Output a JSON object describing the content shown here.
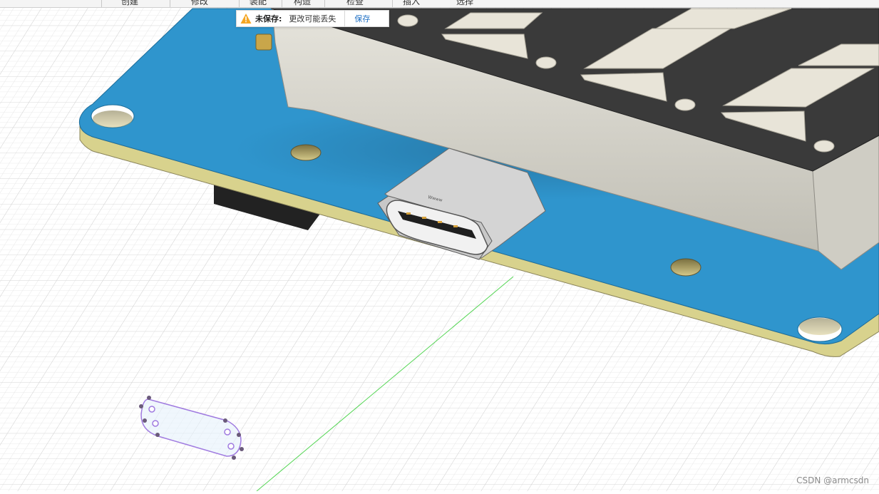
{
  "menu": {
    "items": [
      "创建",
      "修改",
      "装配",
      "构造",
      "检查",
      "插入",
      "选择"
    ]
  },
  "banner": {
    "title": "未保存:",
    "message": "更改可能丢失",
    "save_label": "保存",
    "warning_icon": "warning-triangle-icon",
    "warning_color": "#f5a623"
  },
  "watermark": "CSDN @armcsdn",
  "colors": {
    "pcb_top": "#2f95cd",
    "pcb_edge": "#d8d28d",
    "display_body": "#d7d5cc",
    "display_face": "#3a3a3a",
    "segment": "#e8e4d8",
    "sketch_outline": "#a07be0",
    "axis_green": "#55d655"
  }
}
